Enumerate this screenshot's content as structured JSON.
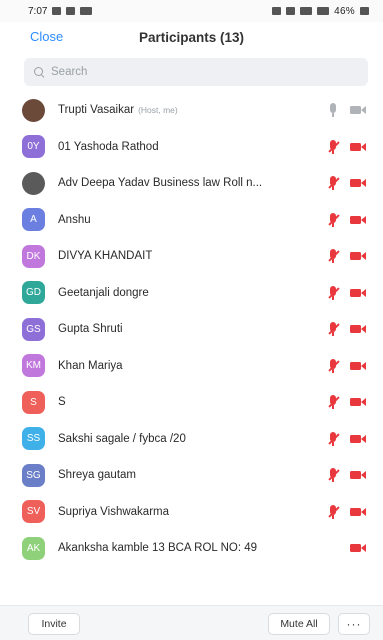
{
  "status_bar": {
    "time": "7:07",
    "indicators": "46%"
  },
  "header": {
    "close_label": "Close",
    "title": "Participants (13)"
  },
  "search": {
    "placeholder": "Search"
  },
  "participants": [
    {
      "name": "Trupti Vasaikar",
      "tag": "(Host, me)",
      "initials": "",
      "avatar": "photo",
      "color": "#6b4a3a",
      "mic": "on",
      "video": "on"
    },
    {
      "name": "01 Yashoda Rathod",
      "initials": "0Y",
      "color": "#8e6fd8",
      "mic": "muted",
      "video": "muted"
    },
    {
      "name": "Adv Deepa Yadav Business law Roll n...",
      "initials": "",
      "avatar": "photo",
      "color": "#5a5a5a",
      "mic": "muted",
      "video": "muted"
    },
    {
      "name": "Anshu",
      "initials": "A",
      "color": "#6b7fe0",
      "mic": "muted",
      "video": "muted"
    },
    {
      "name": "DIVYA KHANDAIT",
      "initials": "DK",
      "color": "#c078dd",
      "mic": "muted",
      "video": "muted"
    },
    {
      "name": "Geetanjali dongre",
      "initials": "GD",
      "color": "#2fa89a",
      "mic": "muted",
      "video": "muted"
    },
    {
      "name": "Gupta Shruti",
      "initials": "GS",
      "color": "#8e6fd8",
      "mic": "muted",
      "video": "muted"
    },
    {
      "name": "Khan Mariya",
      "initials": "KM",
      "color": "#c078dd",
      "mic": "muted",
      "video": "muted"
    },
    {
      "name": "S",
      "initials": "S",
      "color": "#f0605a",
      "mic": "muted",
      "video": "muted"
    },
    {
      "name": "Sakshi sagale / fybca /20",
      "initials": "SS",
      "color": "#3fb0e8",
      "mic": "muted",
      "video": "muted"
    },
    {
      "name": "Shreya gautam",
      "initials": "SG",
      "color": "#6b7fc8",
      "mic": "muted",
      "video": "muted"
    },
    {
      "name": "Supriya Vishwakarma",
      "initials": "SV",
      "color": "#f0605a",
      "mic": "muted",
      "video": "muted"
    },
    {
      "name": "Akanksha kamble 13 BCA ROL NO: 49",
      "initials": "AK",
      "color": "#8fd07a",
      "mic": "none",
      "video": "muted"
    }
  ],
  "footer": {
    "invite_label": "Invite",
    "mute_all_label": "Mute All",
    "more_label": "···"
  }
}
